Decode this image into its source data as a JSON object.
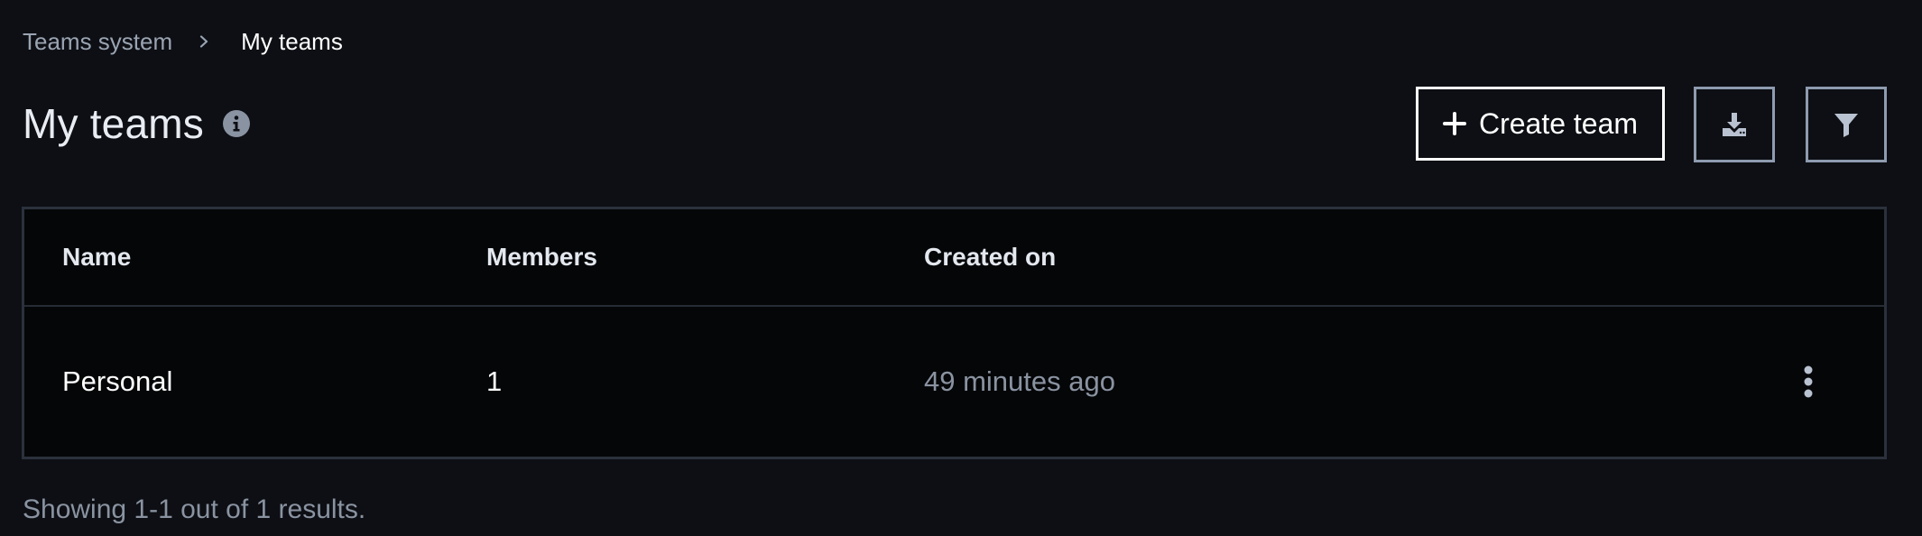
{
  "breadcrumb": {
    "parent": "Teams system",
    "current": "My teams"
  },
  "header": {
    "title": "My teams",
    "create_button_label": "Create team"
  },
  "table": {
    "columns": [
      "Name",
      "Members",
      "Created on"
    ],
    "rows": [
      {
        "name": "Personal",
        "members": "1",
        "created_on": "49 minutes ago"
      }
    ]
  },
  "footer": {
    "results_text": "Showing 1-1 out of 1 results."
  },
  "icons": {
    "breadcrumb_separator": "chevron-right-icon",
    "title_info": "info-icon",
    "create": "plus-icon",
    "download": "download-icon",
    "filter": "filter-icon",
    "row_actions": "kebab-menu-icon"
  },
  "colors": {
    "background": "#0d0f14",
    "table_background": "#050608",
    "border": "#2b313c",
    "muted_text": "#8a93a1",
    "icon_button_border": "#8e9bb0"
  }
}
